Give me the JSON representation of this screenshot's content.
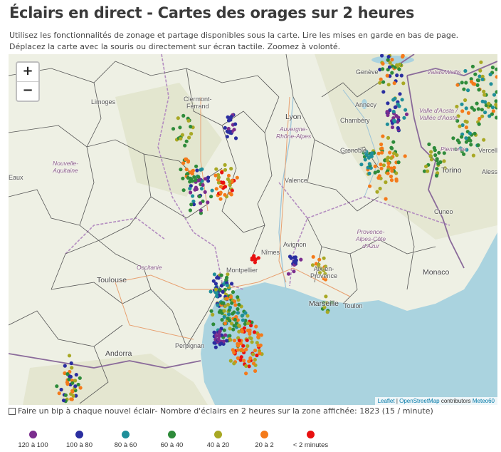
{
  "header": {
    "title": "Éclairs en direct - Cartes des orages sur 2 heures",
    "intro_line1": "Utilisez les fonctionnalités de zonage et partage disponibles sous la carte. Lire les mises en garde en bas de page.",
    "intro_line2": "Déplacez la carte avec la souris ou directement sur écran tactile. Zoomez à volonté."
  },
  "map": {
    "zoom_in": "+",
    "zoom_out": "−",
    "attribution": {
      "leaflet": "Leaflet",
      "sep": " | ",
      "osm": "OpenStreetMap",
      "contributors": " contributors ",
      "meteo": "Meteo60"
    },
    "colors": {
      "sea": "#aad3df",
      "land": "#eef0e4"
    },
    "labels": {
      "limoges": "Limoges",
      "clermont": "Clermont-\nFerrand",
      "lyon": "Lyon",
      "auvergne": "Auvergne-\nRhône-Alpes",
      "geneve": "Genève",
      "annecy": "Annecy",
      "chambery": "Chambéry",
      "grenoble": "Grenoble",
      "valais": "Valais/Wallis",
      "aoste": "Valle d'Aosta /\nVallée d'Aoste",
      "piemonte": "Piemonte",
      "torino": "Torino",
      "vercelli": "Vercell",
      "alessandria": "Alessa",
      "cuneo": "Cuneo",
      "nouvelle": "Nouvelle-\nAquitaine",
      "valence": "Valence",
      "paca": "Provence-\nAlpes-Côte\nd'Azur",
      "occitanie": "Occitanie",
      "toulouse": "Toulouse",
      "nimes": "Nîmes",
      "avignon": "Avignon",
      "montpellier": "Montpellier",
      "aix": "Aix-en-\nProvence",
      "marseille": "Marseille",
      "toulon": "Toulon",
      "monaco": "Monaco",
      "perpignan": "Perpignan",
      "andorra": "Andorra",
      "eaux": "Eaux"
    }
  },
  "beep": {
    "label": "Faire un bip à chaque nouvel éclair",
    "count_text": " - Nombre d'éclairs en 2 heures sur la zone affichée: 1823 (15 / minute)"
  },
  "legend": [
    {
      "label": "120 à 100",
      "color": "#7b2d8e"
    },
    {
      "label": "100 à 80",
      "color": "#2a2ea0"
    },
    {
      "label": "80 à 60",
      "color": "#1f8f9a"
    },
    {
      "label": "60 à 40",
      "color": "#2e8b3a"
    },
    {
      "label": "40 à 20",
      "color": "#a8a824"
    },
    {
      "label": "20 à 2",
      "color": "#f47a1a"
    },
    {
      "label": "< 2 minutes",
      "color": "#e81010"
    }
  ]
}
